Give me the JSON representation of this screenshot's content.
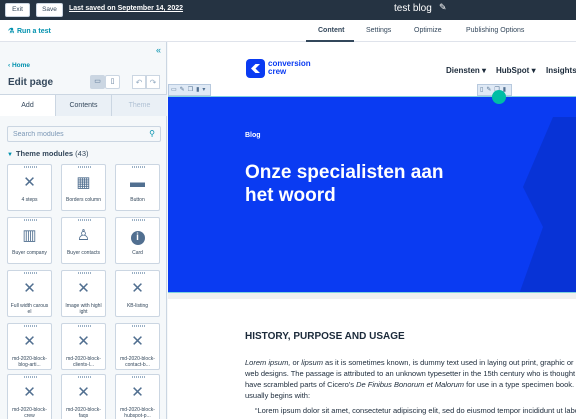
{
  "topbar": {
    "exit_label": "Exit",
    "save_label": "Save",
    "last_saved": "Last saved on September 14, 2022",
    "page_title": "test blog"
  },
  "toolbar2": {
    "run_test_label": "Run a test",
    "tabs": [
      "Content",
      "Settings",
      "Optimize",
      "Publishing Options"
    ],
    "active_tab": "Content"
  },
  "sidebar": {
    "breadcrumb": "Home",
    "title": "Edit page",
    "tabs": [
      "Add",
      "Contents",
      "Theme"
    ],
    "search_placeholder": "Search modules",
    "section_title": "Theme modules",
    "section_count": "(43)",
    "modules": [
      {
        "label": "4 steps",
        "icon": "tools-icon"
      },
      {
        "label": "Borders column",
        "icon": "table-icon"
      },
      {
        "label": "Button",
        "icon": "button-icon"
      },
      {
        "label": "Buyer company",
        "icon": "building-icon"
      },
      {
        "label": "Buyer contacts",
        "icon": "user-icon"
      },
      {
        "label": "Card",
        "icon": "info-icon"
      },
      {
        "label": "Full width carous el",
        "icon": "tools-icon"
      },
      {
        "label": "Image with highl ight",
        "icon": "tools-icon"
      },
      {
        "label": "KB-listing",
        "icon": "tools-icon"
      },
      {
        "label": "md-2020-block-blog-arti...",
        "icon": "tools-icon"
      },
      {
        "label": "md-2020-block-clients-l...",
        "icon": "tools-icon"
      },
      {
        "label": "md-2020-block-contact-b...",
        "icon": "tools-icon"
      },
      {
        "label": "md-2020-block-crew",
        "icon": "tools-icon"
      },
      {
        "label": "md-2020-block-faqs",
        "icon": "tools-icon"
      },
      {
        "label": "md-2020-block-hubspot-p...",
        "icon": "tools-icon"
      }
    ]
  },
  "site": {
    "logo_line1": "conversion",
    "logo_line2": "crew",
    "nav": [
      "Diensten",
      "HubSpot",
      "Insights"
    ],
    "hero_label": "Blog",
    "hero_title": "Onze specialisten aan het woord",
    "brand_color": "#0a3bf2",
    "article_heading": "HISTORY, PURPOSE AND USAGE",
    "article_p_em1": "Lorem ipsum,",
    "article_p_or": " or ",
    "article_p_em2": "lipsum",
    "article_p_rest": " as it is sometimes known, is dummy text used in laying out print, graphic or web designs. The passage is attributed to an unknown typesetter in the 15th century who is thought to have scrambled parts of Cicero's ",
    "article_p_em3": "De Finibus Bonorum et Malorum",
    "article_p_end": " for use in a type specimen book. It usually begins with:",
    "article_quote": "“Lorem ipsum dolor sit amet, consectetur adipiscing elit, sed do eiusmod tempor incididunt ut labore et dolore magna aliqua.”"
  }
}
